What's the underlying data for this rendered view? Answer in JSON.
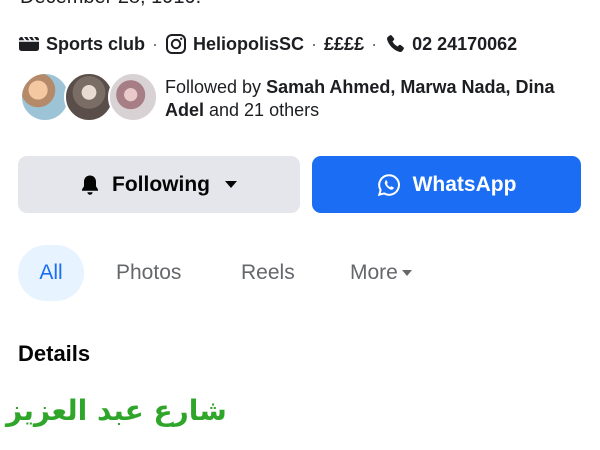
{
  "intro": {
    "date_line": "December 28, 1910."
  },
  "info": {
    "category": "Sports club",
    "instagram": "HeliopolisSC",
    "price": "££££",
    "phone": "02 24170062",
    "separator": "·"
  },
  "followers": {
    "prefix": "Followed by ",
    "names": "Samah Ahmed, Marwa Nada, Dina Adel",
    "suffix": " and 21 others"
  },
  "actions": {
    "following_label": "Following",
    "whatsapp_label": "WhatsApp"
  },
  "tabs": [
    {
      "label": "All",
      "active": true
    },
    {
      "label": "Photos"
    },
    {
      "label": "Reels"
    },
    {
      "label": "More"
    }
  ],
  "details": {
    "title": "Details"
  },
  "watermark": {
    "text": "شارع عبد العزيز"
  },
  "colors": {
    "accent": "#1b6ef3",
    "button_gray": "#e4e6eb",
    "active_tab_bg": "#e7f3ff",
    "watermark": "#2fa52a"
  }
}
